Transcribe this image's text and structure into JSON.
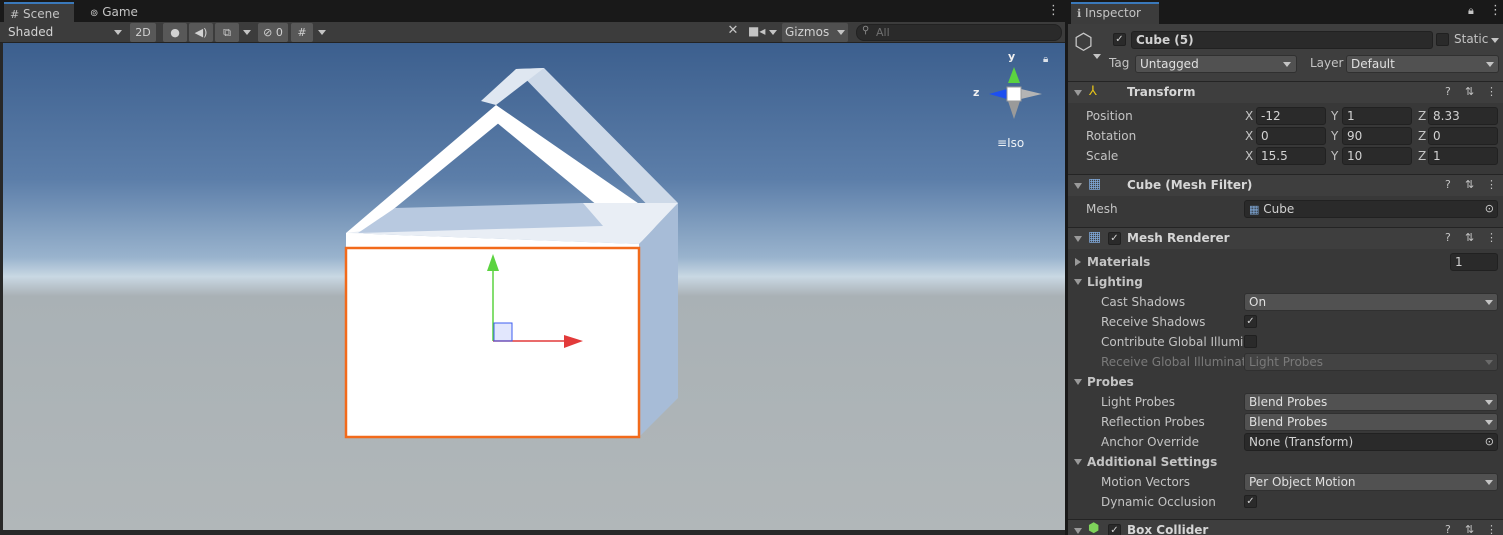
{
  "tabs": {
    "scene": "Scene",
    "game": "Game"
  },
  "toolbar": {
    "shading_mode": "Shaded",
    "mode_2d": "2D",
    "hidden_count": "0",
    "gizmos": "Gizmos",
    "search_placeholder": "All"
  },
  "gizmo": {
    "y": "y",
    "z": "z",
    "projection": "Iso"
  },
  "inspector": {
    "tab": "Inspector",
    "object_name": "Cube (5)",
    "static_label": "Static",
    "tag_label": "Tag",
    "tag_value": "Untagged",
    "layer_label": "Layer",
    "layer_value": "Default",
    "transform": {
      "title": "Transform",
      "position_label": "Position",
      "rotation_label": "Rotation",
      "scale_label": "Scale",
      "position": {
        "x": "-12",
        "y": "1",
        "z": "8.33"
      },
      "rotation": {
        "x": "0",
        "y": "90",
        "z": "0"
      },
      "scale": {
        "x": "15.5",
        "y": "10",
        "z": "1"
      },
      "axis_x": "X",
      "axis_y": "Y",
      "axis_z": "Z"
    },
    "mesh_filter": {
      "title": "Cube (Mesh Filter)",
      "mesh_label": "Mesh",
      "mesh_value": "Cube"
    },
    "mesh_renderer": {
      "title": "Mesh Renderer",
      "materials_label": "Materials",
      "materials_count": "1",
      "lighting_label": "Lighting",
      "cast_shadows_label": "Cast Shadows",
      "cast_shadows_value": "On",
      "receive_shadows_label": "Receive Shadows",
      "contribute_gi_label": "Contribute Global Illumina",
      "receive_gi_label": "Receive Global Illuminatio",
      "receive_gi_value": "Light Probes",
      "probes_label": "Probes",
      "light_probes_label": "Light Probes",
      "light_probes_value": "Blend Probes",
      "reflection_probes_label": "Reflection Probes",
      "reflection_probes_value": "Blend Probes",
      "anchor_override_label": "Anchor Override",
      "anchor_override_value": "None (Transform)",
      "additional_settings_label": "Additional Settings",
      "motion_vectors_label": "Motion Vectors",
      "motion_vectors_value": "Per Object Motion",
      "dynamic_occlusion_label": "Dynamic Occlusion"
    },
    "box_collider": {
      "title": "Box Collider"
    }
  },
  "colors": {
    "selection_outline": "#f26a1b",
    "accent_tab": "#3a79bb",
    "axis_x": "#e23a3a",
    "axis_y": "#5bd340",
    "axis_z": "#3c5cf0"
  }
}
